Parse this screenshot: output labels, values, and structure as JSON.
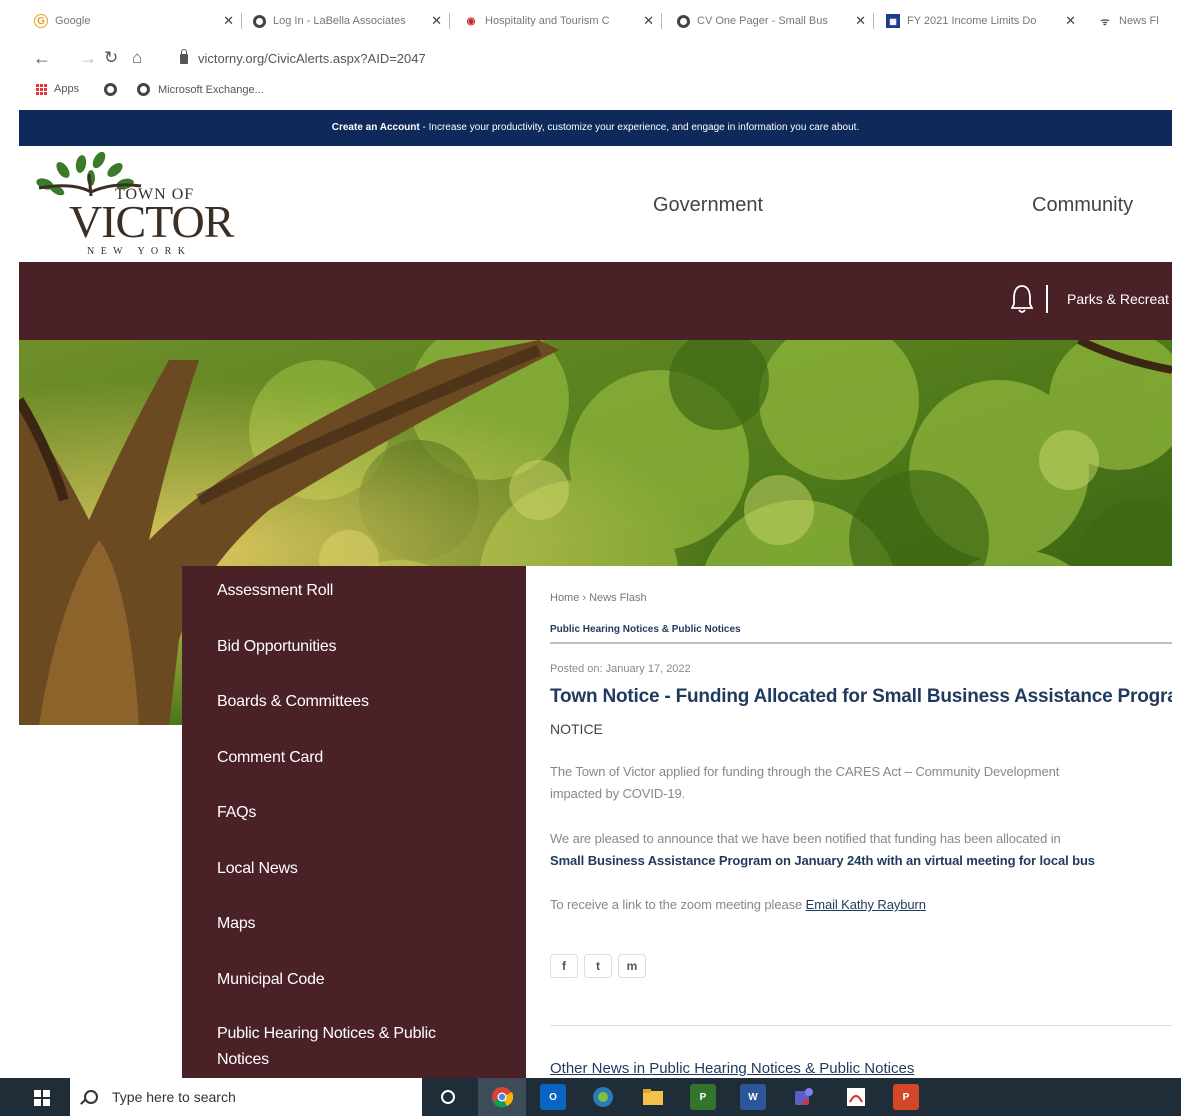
{
  "browser": {
    "tabs": [
      {
        "title": "Google",
        "icon": "google-icon",
        "color": "#e8a020",
        "letter": "G"
      },
      {
        "title": "Log In - LaBella Associates",
        "icon": "globe-icon",
        "color": "#444444",
        "letter": ""
      },
      {
        "title": "Hospitality and Tourism C",
        "icon": "eye-icon",
        "color": "#c62828",
        "letter": ""
      },
      {
        "title": "CV One Pager - Small Bus",
        "icon": "globe-icon",
        "color": "#444444",
        "letter": ""
      },
      {
        "title": "FY 2021 Income Limits Do",
        "icon": "hud-icon",
        "color": "#1a3c8c",
        "letter": ""
      },
      {
        "title": "News Fl",
        "icon": "broadcast-icon",
        "color": "#555555",
        "letter": ""
      }
    ],
    "url": "victorny.org/CivicAlerts.aspx?AID=2047",
    "bookmarks": {
      "apps": "Apps",
      "exchange": "Microsoft Exchange..."
    }
  },
  "site": {
    "account_bar": {
      "link": "Create an Account",
      "text": " - Increase your productivity, customize your experience, and engage in information you care about."
    },
    "logo": {
      "town_of": "TOWN OF",
      "victor": "VICTOR",
      "state": "N E W   Y O R K"
    },
    "main_nav": [
      "Government",
      "Community"
    ],
    "utility_link": "Parks & Recreat",
    "side_menu": [
      "Assessment Roll",
      "Bid Opportunities",
      "Boards & Committees",
      "Comment Card",
      "FAQs",
      "Local News",
      "Maps",
      "Municipal Code",
      "Public Hearing Notices & Public Notices"
    ],
    "article": {
      "breadcrumb": "Home › News Flash",
      "category": "Public Hearing Notices & Public Notices",
      "posted": "Posted on: January 17, 2022",
      "title": "Town Notice - Funding Allocated for Small Business Assistance Program",
      "notice": "NOTICE",
      "p1_line1": "The Town of Victor applied for funding through the CARES Act – Community Development",
      "p1_line2": "impacted by COVID-19.",
      "p2_line1": "We are pleased to announce that we have been notified that funding has been allocated in",
      "p2_line2": "Small Business Assistance Program on January 24th with an virtual meeting for local bus",
      "p3_text": "To receive a link to the zoom meeting please ",
      "p3_link": "Email Kathy Rayburn",
      "share": [
        "f",
        "t",
        "m"
      ],
      "other_news": "Other News in Public Hearing Notices & Public Notices"
    },
    "colors": {
      "navy": "#0f2a5a",
      "maroon": "#4a2127",
      "title": "#1f3a5e"
    }
  },
  "taskbar": {
    "search_placeholder": "Type here to search",
    "apps": [
      "chrome-icon",
      "outlook-icon",
      "browser-icon",
      "file-explorer-icon",
      "project-icon",
      "word-icon",
      "teams-icon",
      "acrobat-icon",
      "powerpoint-icon"
    ]
  }
}
